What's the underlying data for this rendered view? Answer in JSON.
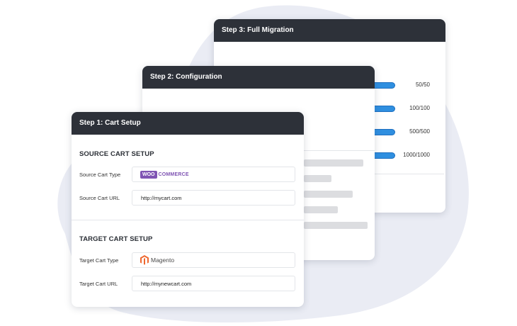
{
  "colors": {
    "header_bg": "#2d3139",
    "blob": "#eaecf4",
    "progress_fill": "#2f8fe0",
    "woo_purple": "#7f54b3",
    "magento_orange": "#ee672f"
  },
  "step3": {
    "title": "Step 3: Full Migration",
    "progress": [
      {
        "value": "50/50",
        "fraction": 1.0
      },
      {
        "value": "100/100",
        "fraction": 1.0
      },
      {
        "value": "500/500",
        "fraction": 1.0
      },
      {
        "value": "1000/1000",
        "fraction": 1.0
      }
    ]
  },
  "step2": {
    "title": "Step 2: Configuration"
  },
  "step1": {
    "title": "Step 1: Cart Setup",
    "source": {
      "section_title": "SOURCE CART SETUP",
      "type_label": "Source Cart Type",
      "type_logo": {
        "icon": "woocommerce-logo",
        "badge": "WOO",
        "word": "COMMERCE"
      },
      "url_label": "Source Cart URL",
      "url_value": "http://mycart.com"
    },
    "target": {
      "section_title": "TARGET CART SETUP",
      "type_label": "Target Cart Type",
      "type_logo": {
        "icon": "magento-logo",
        "word": "Magento"
      },
      "url_label": "Target Cart URL",
      "url_value": "http://mynewcart.com"
    }
  }
}
